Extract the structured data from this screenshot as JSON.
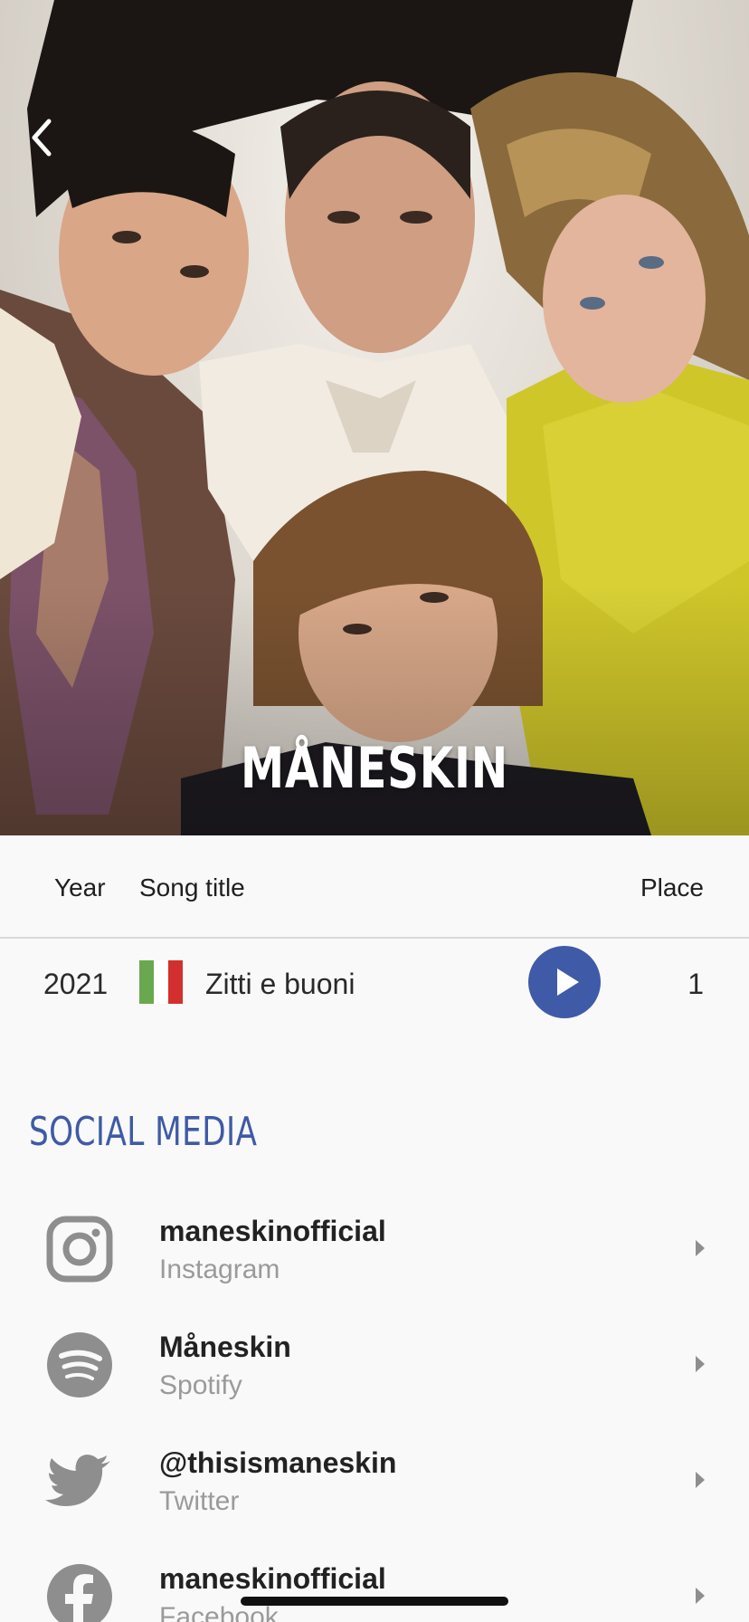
{
  "hero": {
    "artist_name": "MÅNESKIN",
    "back_icon": "chevron-left-icon"
  },
  "table": {
    "headers": {
      "year": "Year",
      "song": "Song title",
      "place": "Place"
    },
    "rows": [
      {
        "year": "2021",
        "country_flag": "italy-flag-icon",
        "flag_colors": [
          "#6aa84f",
          "#ffffff",
          "#d32f2f"
        ],
        "song": "Zitti e buoni",
        "play_icon": "play-icon",
        "place": "1"
      }
    ]
  },
  "social": {
    "title": "SOCIAL MEDIA",
    "items": [
      {
        "handle": "maneskinofficial",
        "platform": "Instagram",
        "icon": "instagram-icon"
      },
      {
        "handle": "Måneskin",
        "platform": "Spotify",
        "icon": "spotify-icon"
      },
      {
        "handle": "@thisismaneskin",
        "platform": "Twitter",
        "icon": "twitter-icon"
      },
      {
        "handle": "maneskinofficial",
        "platform": "Facebook",
        "icon": "facebook-icon"
      }
    ]
  },
  "colors": {
    "accent": "#3f5aa6",
    "icon_gray": "#8e8e8e",
    "background": "#f9f9f9"
  }
}
